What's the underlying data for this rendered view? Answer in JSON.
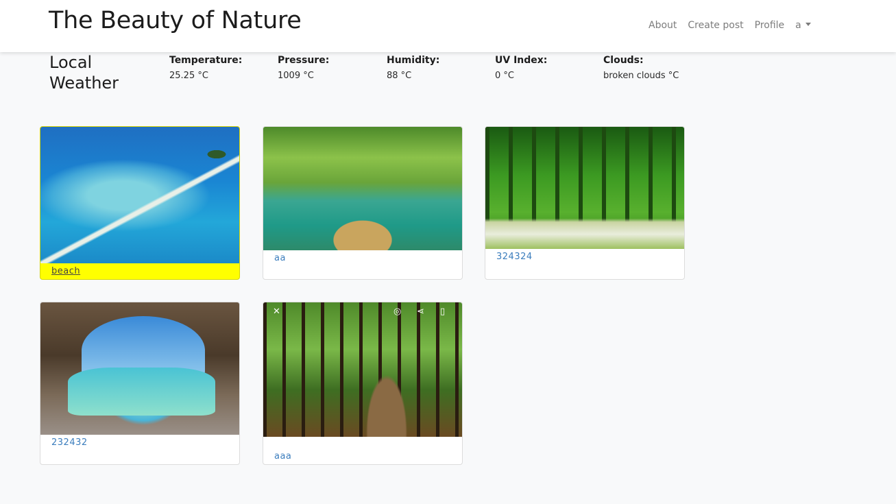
{
  "brand": "The Beauty of Nature",
  "nav": {
    "about": "About",
    "create_post": "Create post",
    "profile": "Profile",
    "user_menu": "a"
  },
  "weather": {
    "title": "Local Weather",
    "items": [
      {
        "label": "Temperature:",
        "value": "25.25 °C"
      },
      {
        "label": "Pressure:",
        "value": "1009 °C"
      },
      {
        "label": "Humidity:",
        "value": "88 °C"
      },
      {
        "label": "UV Index:",
        "value": "0 °C"
      },
      {
        "label": "Clouds:",
        "value": "broken clouds °C"
      }
    ]
  },
  "posts": [
    {
      "caption": "beach",
      "image": "aerial-beach-sandbar-photo",
      "highlighted": true
    },
    {
      "caption": "aa",
      "image": "bamboo-raft-river-photo"
    },
    {
      "caption": "324324",
      "image": "forest-path-walkers-photo"
    },
    {
      "caption": "232432",
      "image": "sea-cave-beach-photo"
    },
    {
      "caption": "aaa",
      "image": "forest-road-logs-photo"
    }
  ],
  "colors": {
    "highlight": "#ffff00",
    "link": "#3b7dbd",
    "background": "#f8f9fa"
  }
}
